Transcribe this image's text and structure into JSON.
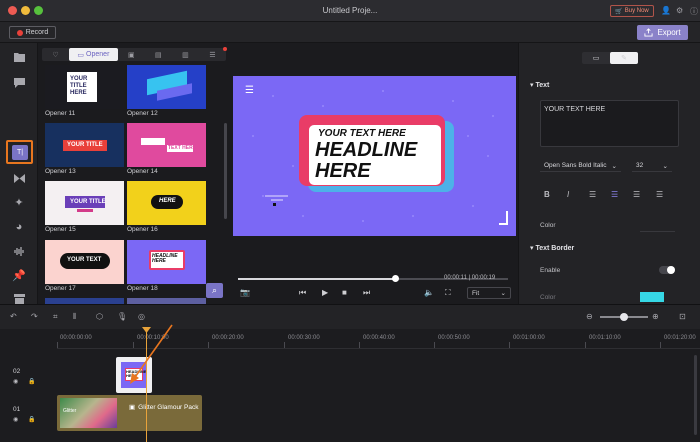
{
  "window": {
    "title": "Untitled Proje...",
    "buy_now": "Buy Now"
  },
  "toolbar": {
    "record_label": "Record",
    "export_label": "Export"
  },
  "sidebar": {
    "items": [
      "media-icon",
      "chat-icon",
      "text-icon",
      "transition-icon",
      "magic-icon",
      "sticker-icon",
      "audio-icon",
      "pin-icon",
      "template-icon"
    ]
  },
  "library": {
    "active_tab": "Opener",
    "items": [
      {
        "label": "Opener 11",
        "thumb_text": "YOUR TITLE HERE"
      },
      {
        "label": "Opener 12",
        "thumb_text": ""
      },
      {
        "label": "Opener 13",
        "thumb_text": "YOUR TITLE"
      },
      {
        "label": "Opener 14",
        "thumb_text": "TEXT HERE"
      },
      {
        "label": "Opener 15",
        "thumb_text": "YOUR TITLE"
      },
      {
        "label": "Opener 16",
        "thumb_text": "HERE"
      },
      {
        "label": "Opener 17",
        "thumb_text": "YOUR TEXT"
      },
      {
        "label": "Opener 18",
        "thumb_text": "HEADLINE HERE"
      }
    ]
  },
  "preview": {
    "small_text": "YOUR TEXT HERE",
    "headline_line1": "HEADLINE",
    "headline_line2": "HERE",
    "timecode": "00:00:11 | 00:00:19",
    "progress_fraction": 0.58,
    "fit_label": "Fit"
  },
  "props": {
    "text_section": "Text",
    "text_value": "YOUR TEXT HERE",
    "font_family": "Open Sans Bold Italic",
    "font_size": "32",
    "color_label": "Color",
    "border_section": "Text Border",
    "enable_label": "Enable",
    "border_color_label": "Color",
    "border_color": "#36d8e6"
  },
  "timeline": {
    "ruler": [
      "00:00:00:00",
      "00:00:10:00",
      "00:00:20:00",
      "00:00:30:00",
      "00:00:40:00",
      "00:00:50:00",
      "00:01:00:00",
      "00:01:10:00",
      "00:01:20:00"
    ],
    "tracks": [
      {
        "number": "02"
      },
      {
        "number": "01"
      }
    ],
    "clip_title_text": "HEADLINE HERE",
    "clip_glitter_label": "Glitter Glamour Pack",
    "clip_glitter_thumb_text": "Glitter"
  }
}
